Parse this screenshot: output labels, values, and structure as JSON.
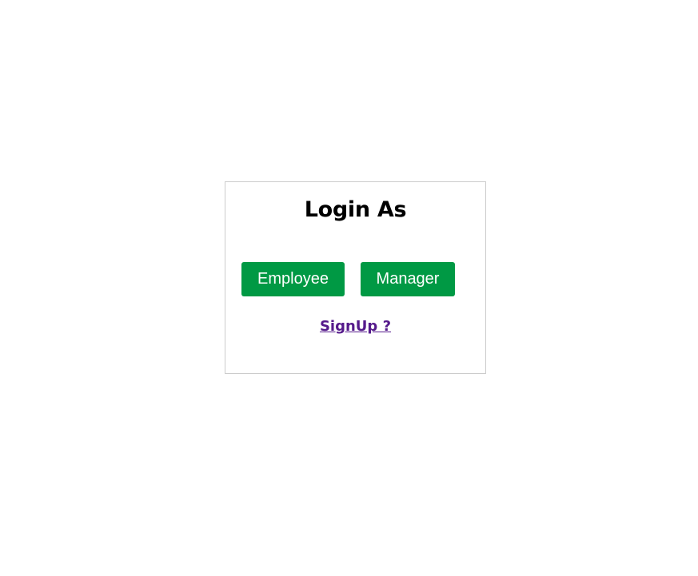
{
  "login": {
    "title": "Login As",
    "buttons": {
      "employee": "Employee",
      "manager": "Manager"
    },
    "signup_link": "SignUp ?"
  },
  "colors": {
    "accent": "#009944",
    "link": "#551a8b",
    "card_border": "#cccccc"
  }
}
